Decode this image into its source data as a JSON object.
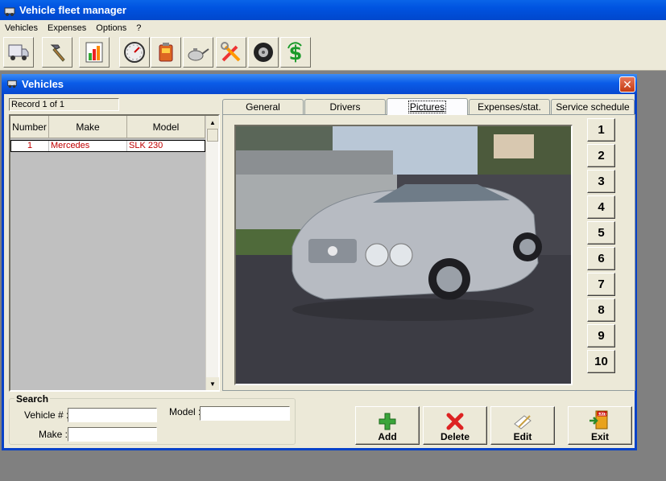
{
  "app": {
    "title": "Vehicle fleet manager"
  },
  "menu": [
    "Vehicles",
    "Expenses",
    "Options",
    "?"
  ],
  "toolbar": {
    "icons": [
      "truck-icon",
      "hammer-icon",
      "chart-icon",
      "speedometer-icon",
      "fuel-can-icon",
      "oil-can-icon",
      "tools-icon",
      "tire-icon",
      "money-icon"
    ]
  },
  "window": {
    "title": "Vehicles",
    "close": "✕"
  },
  "record": "Record 1 of 1",
  "grid": {
    "columns": [
      "Number",
      "Make",
      "Model"
    ],
    "rows": [
      {
        "number": "1",
        "make": "Mercedes",
        "model": "SLK 230"
      }
    ]
  },
  "tabs": [
    "General",
    "Drivers",
    "Pictures",
    "Expenses/stat.",
    "Service schedule"
  ],
  "active_tab": "Pictures",
  "picture_buttons": [
    "1",
    "2",
    "3",
    "4",
    "5",
    "6",
    "7",
    "8",
    "9",
    "10"
  ],
  "search": {
    "title": "Search",
    "vehicle_label": "Vehicle # :",
    "make_label": "Make :",
    "model_label": "Model :",
    "vehicle_value": "",
    "make_value": "",
    "model_value": ""
  },
  "actions": {
    "add": "Add",
    "delete": "Delete",
    "edit": "Edit",
    "exit": "Exit",
    "exit_sign": "EXIT"
  }
}
